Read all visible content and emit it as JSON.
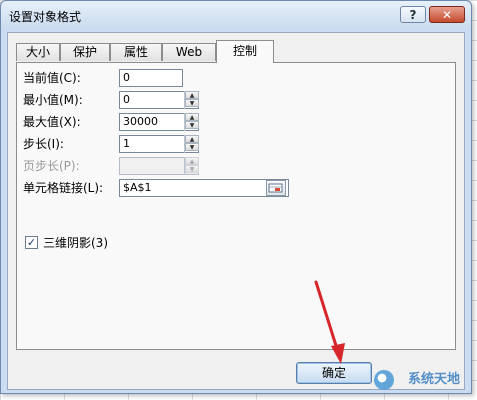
{
  "dialog": {
    "title": "设置对象格式",
    "help_label": "?",
    "close_label": "✕"
  },
  "tabs": [
    {
      "label": "大小",
      "active": false
    },
    {
      "label": "保护",
      "active": false
    },
    {
      "label": "属性",
      "active": false
    },
    {
      "label": "Web",
      "active": false
    },
    {
      "label": "控制",
      "active": true
    }
  ],
  "fields": {
    "current": {
      "label": "当前值(C):",
      "value": "0"
    },
    "min": {
      "label": "最小值(M):",
      "value": "0"
    },
    "max": {
      "label": "最大值(X):",
      "value": "30000"
    },
    "step": {
      "label": "步长(I):",
      "value": "1"
    },
    "page_step": {
      "label": "页步长(P):",
      "value": ""
    },
    "cell_link": {
      "label": "单元格链接(L):",
      "value": "$A$1"
    }
  },
  "checkbox_3d": {
    "label": "三维阴影(3)",
    "checked": true,
    "mark": "✓"
  },
  "ok_button": {
    "label": "确定"
  },
  "watermark": {
    "text": "系统天地"
  },
  "colors": {
    "accent": "#d7262b"
  }
}
